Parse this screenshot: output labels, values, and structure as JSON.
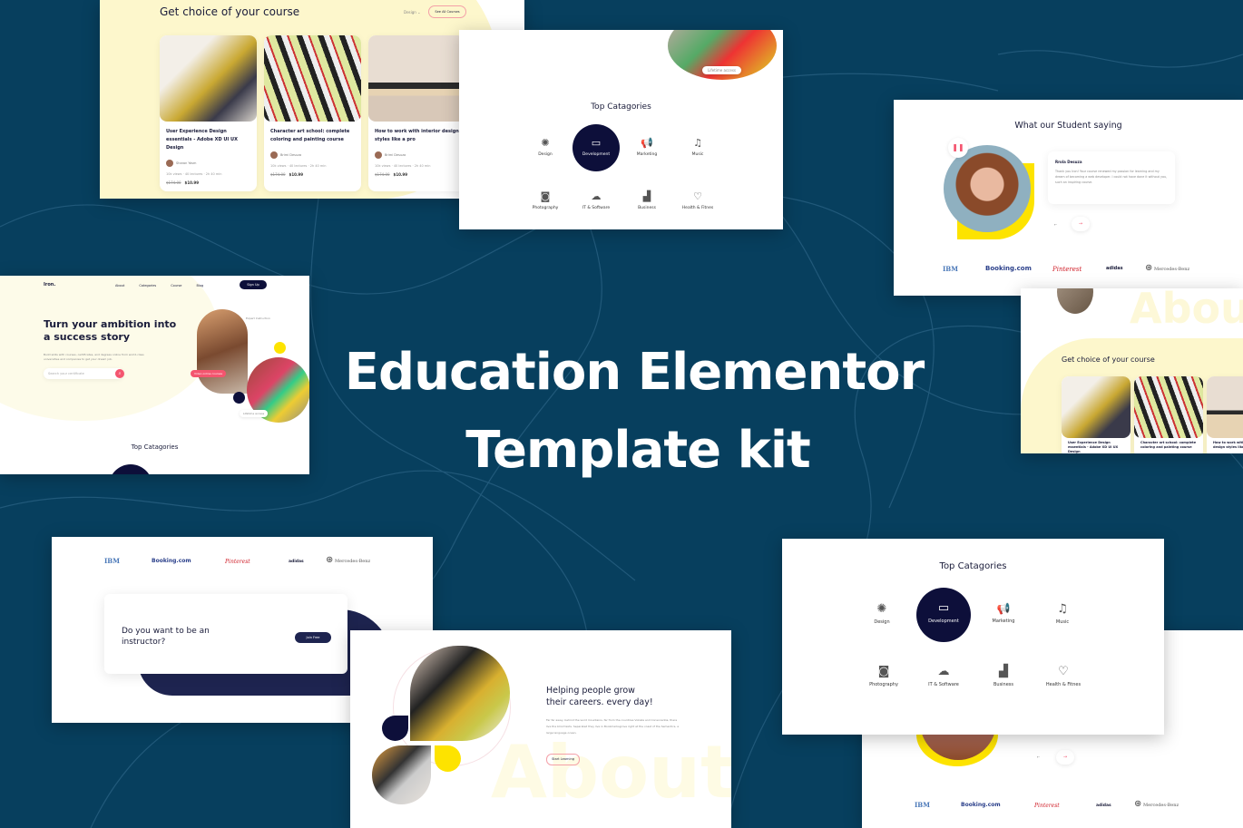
{
  "headline": {
    "line1": "Education Elementor",
    "line2": "Template kit"
  },
  "colors": {
    "background": "#073f5e",
    "navy": "#0d0f3a",
    "yellow": "#fde300",
    "cream": "#fdf7cc",
    "pink": "#f4556f"
  },
  "courses": {
    "title": "Get choice of your course",
    "filter": "Design",
    "see_all": "See All Courses",
    "cards": [
      {
        "title": "User Experience Design essentials - Adobe XD UI UX Design",
        "author": "Sharon Yasm",
        "views": "10k views",
        "lectures": "40 lectures",
        "duration": "2h 40 min",
        "old_price": "$174.00",
        "price": "$10.99"
      },
      {
        "title": "Character art school: complete coloring and painting course",
        "author": "Brimi Desuza",
        "views": "10k views",
        "lectures": "40 lectures",
        "duration": "2h 40 min",
        "old_price": "$174.00",
        "price": "$10.99"
      },
      {
        "title": "How to work with interior design styles like a pro",
        "author": "Brimi Desuza",
        "views": "10k views",
        "lectures": "40 lectures",
        "duration": "2h 40 min",
        "old_price": "$174.00",
        "price": "$10.99"
      }
    ]
  },
  "categories": {
    "title": "Top Catagories",
    "items": [
      {
        "label": "Design",
        "icon": "palette-icon"
      },
      {
        "label": "Development",
        "icon": "monitor-code-icon"
      },
      {
        "label": "Marketing",
        "icon": "megaphone-icon"
      },
      {
        "label": "Music",
        "icon": "music-note-icon"
      },
      {
        "label": "Photography",
        "icon": "camera-icon"
      },
      {
        "label": "IT & Software",
        "icon": "cloud-icon"
      },
      {
        "label": "Business",
        "icon": "chart-icon"
      },
      {
        "label": "Health & Fitnes",
        "icon": "heart-pulse-icon"
      }
    ],
    "badge": "Lifetime access"
  },
  "testimonial": {
    "title": "What our Student saying",
    "name": "Rrola Desuza",
    "quote": "Thank you Iron! Your course renewed my passion for learning and my dream of becoming a web developer. I could not have done it without you, such an inspiring course."
  },
  "logos": [
    "IBM",
    "Booking.com",
    "Pinterest",
    "adidas",
    "Mercedes-Benz"
  ],
  "hero": {
    "brand": "Iron.",
    "nav": [
      "About",
      "Categories",
      "Course",
      "Blog"
    ],
    "signup": "Sign Up",
    "title_line1": "Turn your ambition into",
    "title_line2": "a success story",
    "text": "Build skills with courses, certificates, and degrees online from world-class universities and companies to get your dream job.",
    "search_placeholder": "Search your certificate",
    "badge_expert": "Expert Instruction",
    "badge_video": "Video online courses",
    "badge_lifetime": "Lifetime access",
    "section_title": "Top Catagories"
  },
  "instructor": {
    "title_line1": "Do you want to be an",
    "title_line2": "instructor?",
    "button": "Join Free"
  },
  "about": {
    "title_line1": "Helping people grow",
    "title_line2": "their careers. every day!",
    "text": "Far far away, behind the word mountains, far from the countries Vokalia and Consonantia, there live the blind texts. Separated they live in Bookmarksgrove right at the coast of the Semantics, a large language ocean.",
    "button": "Start Learning",
    "watermark": "About"
  }
}
